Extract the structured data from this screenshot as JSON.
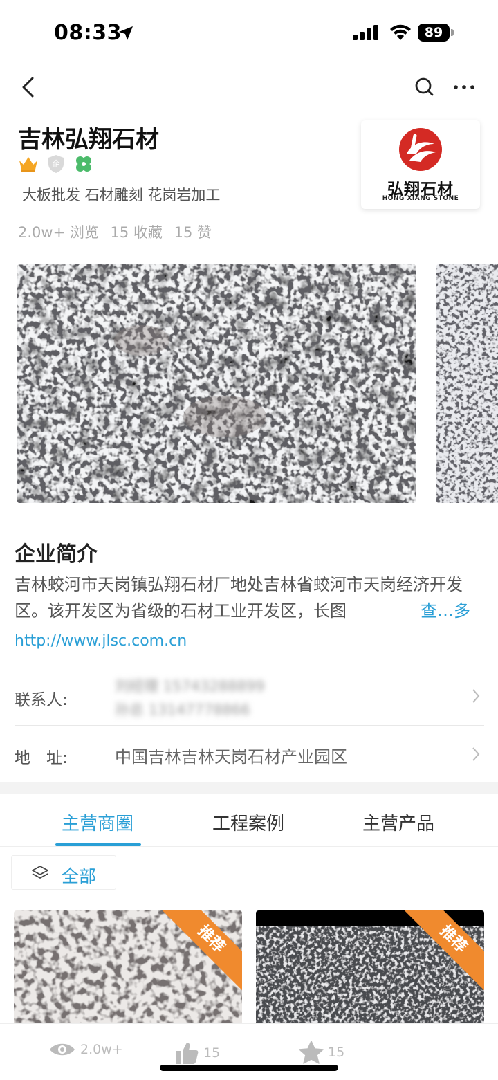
{
  "status_bar": {
    "time": "08:33",
    "battery": "89"
  },
  "company": {
    "name": "吉林弘翔石材",
    "tagline": "大板批发 石材雕刻 花岗岩加工",
    "stats": {
      "views": "2.0w+ 浏览",
      "favorites": "15 收藏",
      "likes": "15 赞"
    },
    "logo_cn": "弘翔石材",
    "logo_en": "HONG XIANG STONE"
  },
  "intro": {
    "title": "企业简介",
    "text": "吉林蛟河市天岗镇弘翔石材厂地处吉林省蛟河市天岗经济开发区。该开发区为省级的石材工业开发区，长图",
    "more": "查…多",
    "website": "http://www.jlsc.com.cn"
  },
  "contact": {
    "label": "联系人:",
    "line1": "刘经理 15743288899",
    "line2": "孙总 13147778866"
  },
  "address": {
    "label": "地　址:",
    "value": "中国吉林吉林天岗石材产业园区"
  },
  "tabs": [
    {
      "label": "主营商圈",
      "active": true
    },
    {
      "label": "工程案例",
      "active": false
    },
    {
      "label": "主营产品",
      "active": false
    }
  ],
  "filter": {
    "label": "全部"
  },
  "products": [
    {
      "ribbon": "推荐"
    },
    {
      "ribbon": "推荐"
    }
  ],
  "bottom_bar": {
    "views": "2.0w+",
    "likes": "15",
    "favorites": "15"
  },
  "colors": {
    "accent": "#2a9fd6",
    "ribbon": "#f08a2e",
    "logo_red": "#d42a24"
  }
}
